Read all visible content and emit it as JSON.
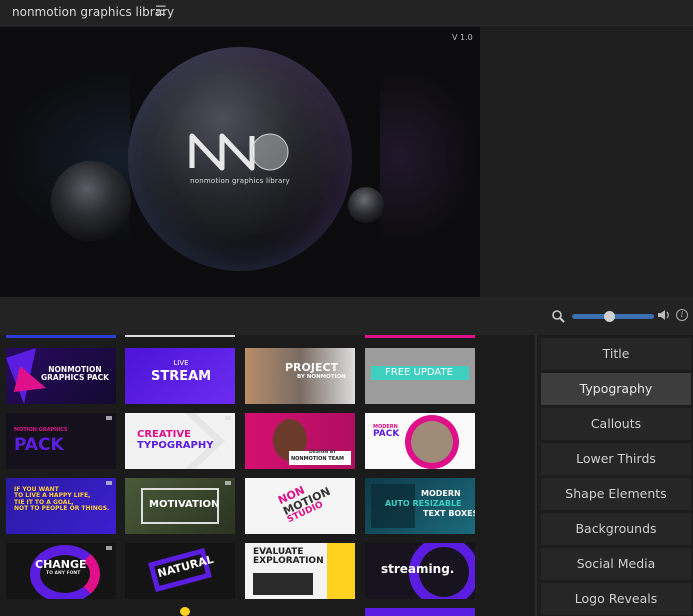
{
  "app": {
    "title": "nonmotion graphics library",
    "menu_icon": "hamburger-icon"
  },
  "preview": {
    "version": "V 1.0",
    "logo_mark": "NM",
    "logo_caption": "nonmotion graphics library"
  },
  "toolbar": {
    "zoom_level": 0.45,
    "icons": [
      "search-icon",
      "volume-icon",
      "info-icon"
    ],
    "info_glyph": "i"
  },
  "thumbnails": [
    {
      "lines": [
        "NONMOTION",
        "GRAPHICS PACK"
      ]
    },
    {
      "lines": [
        "LIVE",
        "STREAM"
      ]
    },
    {
      "lines": [
        "PROJECT",
        "BY NONMOTION"
      ]
    },
    {
      "lines": [
        "FREE UPDATE"
      ]
    },
    {
      "lines": [
        "MOTION GRAPHICS",
        "PACK"
      ]
    },
    {
      "lines": [
        "CREATIVE",
        "TYPOGRAPHY"
      ]
    },
    {
      "lines": [
        "DESIGN BY",
        "NONMOTION TEAM"
      ]
    },
    {
      "lines": [
        "MODERN",
        "PACK"
      ]
    },
    {
      "lines": [
        "IF YOU WANT",
        "TO LIVE A HAPPY LIFE,",
        "TIE IT TO A GOAL,",
        "NOT TO PEOPLE OR THINGS."
      ]
    },
    {
      "lines": [
        "MOTIVATION"
      ]
    },
    {
      "lines": [
        "NON",
        "MOTION",
        "STUDIO"
      ]
    },
    {
      "lines": [
        "MODERN",
        "AUTO RESIZABLE",
        "TEXT BOXES"
      ]
    },
    {
      "lines": [
        "CHANGE",
        "TO ANY FONT"
      ]
    },
    {
      "lines": [
        "NATURAL"
      ]
    },
    {
      "lines": [
        "EVALUATE",
        "EXPLORATION"
      ]
    },
    {
      "lines": [
        "streaming."
      ]
    }
  ],
  "categories": [
    {
      "label": "Title",
      "active": false
    },
    {
      "label": "Typography",
      "active": true
    },
    {
      "label": "Callouts",
      "active": false
    },
    {
      "label": "Lower Thirds",
      "active": false
    },
    {
      "label": "Shape Elements",
      "active": false
    },
    {
      "label": "Backgrounds",
      "active": false
    },
    {
      "label": "Social Media",
      "active": false
    },
    {
      "label": "Logo Reveals",
      "active": false
    }
  ],
  "colors": {
    "accent": "#3a6fb2",
    "magenta": "#e0108a",
    "purple": "#5b1de0",
    "teal": "#3ecfc0"
  }
}
